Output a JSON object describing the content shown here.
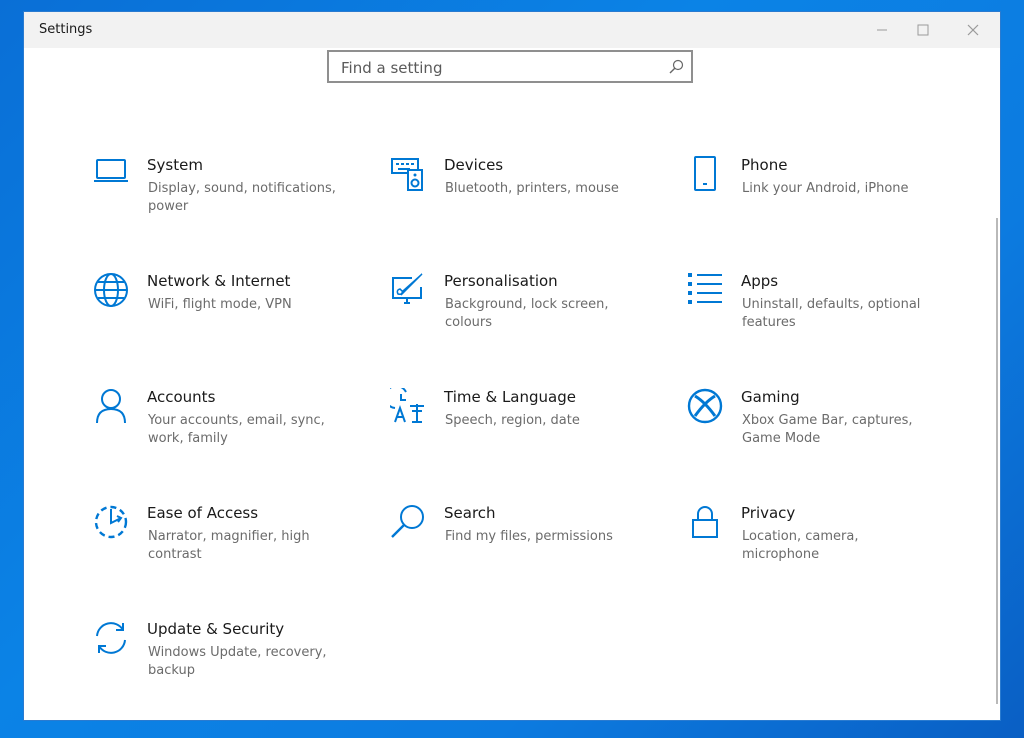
{
  "window": {
    "title": "Settings"
  },
  "search": {
    "placeholder": "Find a setting"
  },
  "tiles": [
    {
      "name": "System",
      "desc": "Display, sound, notifications, power",
      "icon": "laptop-icon"
    },
    {
      "name": "Devices",
      "desc": "Bluetooth, printers, mouse",
      "icon": "keyboard-speaker-icon"
    },
    {
      "name": "Phone",
      "desc": "Link your Android, iPhone",
      "icon": "phone-icon"
    },
    {
      "name": "Network & Internet",
      "desc": "WiFi, flight mode, VPN",
      "icon": "globe-icon"
    },
    {
      "name": "Personalisation",
      "desc": "Background, lock screen, colours",
      "icon": "paint-pen-icon"
    },
    {
      "name": "Apps",
      "desc": "Uninstall, defaults, optional features",
      "icon": "list-icon"
    },
    {
      "name": "Accounts",
      "desc": "Your accounts, email, sync, work, family",
      "icon": "person-icon"
    },
    {
      "name": "Time & Language",
      "desc": "Speech, region, date",
      "icon": "time-language-icon"
    },
    {
      "name": "Gaming",
      "desc": "Xbox Game Bar, captures, Game Mode",
      "icon": "xbox-icon"
    },
    {
      "name": "Ease of Access",
      "desc": "Narrator, magnifier, high contrast",
      "icon": "ease-of-access-icon"
    },
    {
      "name": "Search",
      "desc": "Find my files, permissions",
      "icon": "magnifier-icon"
    },
    {
      "name": "Privacy",
      "desc": "Location, camera, microphone",
      "icon": "lock-icon"
    },
    {
      "name": "Update & Security",
      "desc": "Windows Update, recovery, backup",
      "icon": "sync-icon"
    }
  ],
  "colors": {
    "accent": "#0078d4",
    "titlebar": "#f2f2f2",
    "desktop": "#0a78dc"
  }
}
